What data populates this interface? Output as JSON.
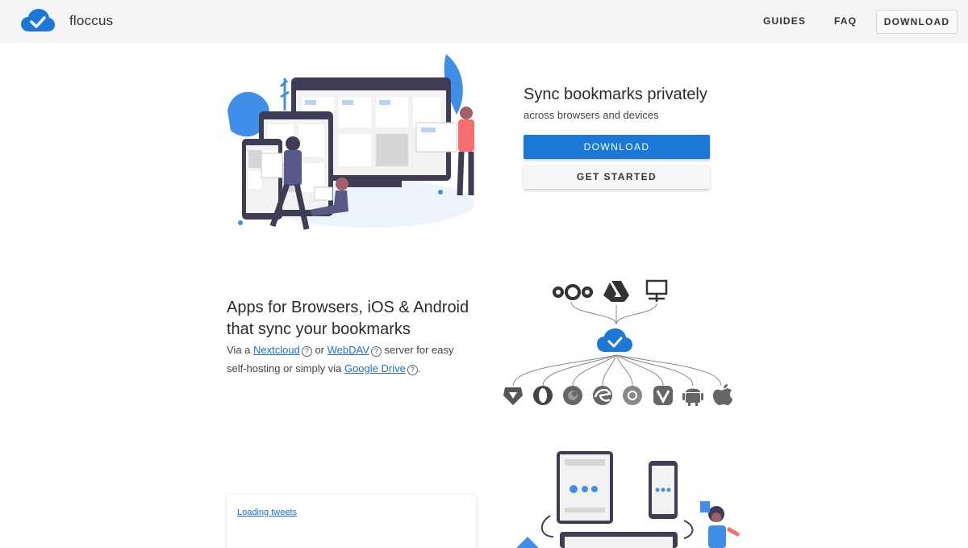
{
  "header": {
    "brand": "floccus",
    "nav": {
      "guides": "GUIDES",
      "faq": "FAQ",
      "download": "DOWNLOAD"
    }
  },
  "hero": {
    "title": "Sync bookmarks privately",
    "subtitle": "across browsers and devices",
    "download_label": "DOWNLOAD",
    "get_started_label": "GET STARTED"
  },
  "apps": {
    "title_line1": "Apps for Browsers, iOS & Android",
    "title_line2": "that sync your bookmarks",
    "desc_via": "Via a ",
    "nextcloud": "Nextcloud",
    "or": " or ",
    "webdav": "WebDAV",
    "desc_server": " server for easy",
    "desc_selfhost": "self-hosting or simply via ",
    "google_drive": "Google Drive",
    "period": ".",
    "qmark": "?"
  },
  "tweets": {
    "loading": "Loading tweets"
  },
  "colors": {
    "accent": "#1c78d7",
    "header_bg": "#f5f5f5",
    "link": "#1c6fc8"
  },
  "icons": [
    "cloud-check-icon",
    "nextcloud-icon",
    "google-drive-icon",
    "server-icon",
    "brave-icon",
    "opera-icon",
    "firefox-icon",
    "edge-icon",
    "chrome-icon",
    "vivaldi-icon",
    "android-icon",
    "apple-icon"
  ]
}
